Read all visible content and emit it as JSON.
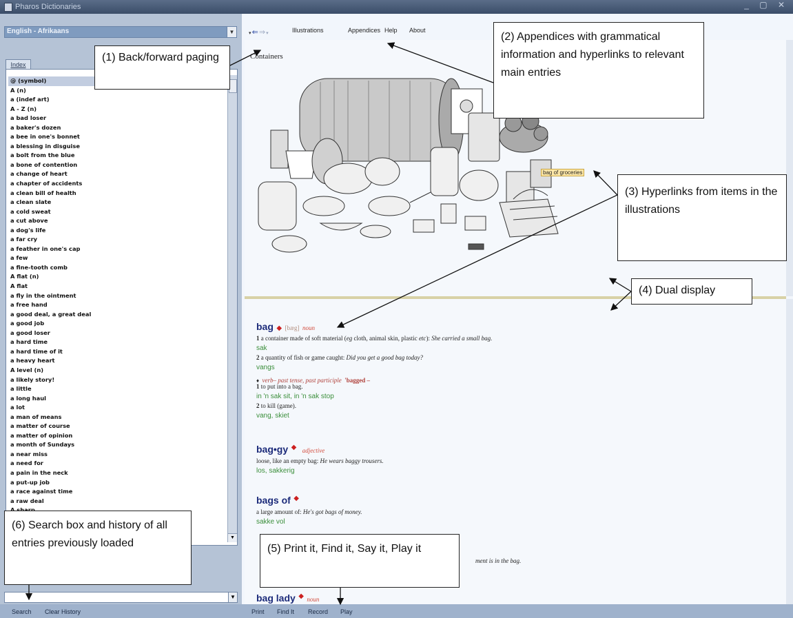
{
  "window": {
    "title": "Pharos Dictionaries",
    "controls": "_ ▢ ✕"
  },
  "left": {
    "language": "English - Afrikaans",
    "index_tab": "Index",
    "entries": [
      "@ (symbol)",
      "A (n)",
      "a (indef art)",
      "A - Z (n)",
      "a bad loser",
      "a baker's dozen",
      "a bee in one's bonnet",
      "a blessing in disguise",
      "a bolt from the blue",
      "a bone of contention",
      "a change of heart",
      "a chapter of accidents",
      "a clean bill of health",
      "a clean slate",
      "a cold sweat",
      "a cut above",
      "a dog's life",
      "a far cry",
      "a feather in one's cap",
      "a few",
      "a fine-tooth comb",
      "A flat (n)",
      "A flat",
      "a fly in the ointment",
      "a free hand",
      "a good deal, a great deal",
      "a good job",
      "a good loser",
      "a hard time",
      "a hard time of it",
      "a heavy heart",
      "A level (n)",
      "a likely story!",
      "a little",
      "a long haul",
      "a lot",
      "a man of means",
      "a matter of course",
      "a matter of opinion",
      "a month of Sundays",
      "a near miss",
      "a need for",
      "a pain in the neck",
      "a put-up job",
      "a race against time",
      "a raw deal",
      "A sharp"
    ],
    "search_value": "",
    "buttons": {
      "search": "Search",
      "clear_history": "Clear History"
    }
  },
  "toolbar": {
    "illustrations": "Illustrations",
    "appendices": "Appendices",
    "help": "Help",
    "about": "About"
  },
  "illustration": {
    "title": "Containers",
    "tooltip": "bag of groceries"
  },
  "entries": {
    "bag": {
      "headword": "bag",
      "pron": "[bæg]",
      "pos": "noun",
      "s1_num": "1",
      "s1_def": "a container made of soft material (",
      "s1_eg": "eg",
      "s1_def2": " cloth, animal skin, plastic ",
      "s1_etc": "etc",
      "s1_def3": "): ",
      "s1_ex": "She carried a small bag.",
      "s1_tr": "sak",
      "s2_num": "2",
      "s2_def": "a quantity of fish or game caught: ",
      "s2_ex": "Did you get a good bag today?",
      "s2_tr": "vangs",
      "verb_line": "verb– past tense, past participle",
      "verb_form": "'bagged –",
      "v1_num": "1",
      "v1_def": "to put into a bag.",
      "v1_tr": "in 'n sak sit, in 'n sak stop",
      "v2_num": "2",
      "v2_def": "to kill (game).",
      "v2_tr": "vang, skiet"
    },
    "baggy": {
      "headword": "bag•gy",
      "pos": "adjective",
      "def": "loose, like an empty bag: ",
      "ex": "He wears baggy trousers.",
      "tr": "los, sakkerig"
    },
    "bags_of": {
      "headword": "bags of",
      "def": "a large amount of: ",
      "ex": "He's got bags of money.",
      "tr": "sakke vol"
    },
    "partial_example": "ment is in the bag.",
    "bag_lady": {
      "headword": "bag lady",
      "pos": "noun"
    }
  },
  "bottom_buttons": {
    "print": "Print",
    "find_it": "Find It",
    "record": "Record",
    "play": "Play"
  },
  "callouts": {
    "c1": "(1) Back/forward paging",
    "c2": "(2) Appendices with grammatical information and hyperlinks to relevant main entries",
    "c3": "(3) Hyperlinks from items in the illustrations",
    "c4": "(4) Dual display",
    "c5": "(5) Print it, Find it, Say it, Play it",
    "c6": "(6) Search box and history of all entries previously loaded"
  }
}
